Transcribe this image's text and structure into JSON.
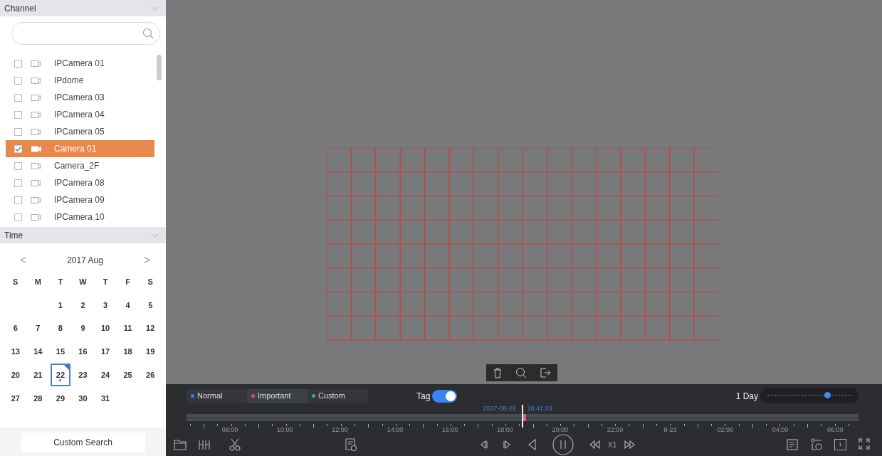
{
  "channel_panel": {
    "title": "Channel",
    "channels": [
      {
        "name": "IPCamera 01",
        "checked": false,
        "selected": false
      },
      {
        "name": "IPdome",
        "checked": false,
        "selected": false
      },
      {
        "name": "IPCamera 03",
        "checked": false,
        "selected": false
      },
      {
        "name": "IPCamera 04",
        "checked": false,
        "selected": false
      },
      {
        "name": "IPCamera 05",
        "checked": false,
        "selected": false
      },
      {
        "name": "Camera 01",
        "checked": true,
        "selected": true
      },
      {
        "name": "Camera_2F",
        "checked": false,
        "selected": false
      },
      {
        "name": "IPCamera 08",
        "checked": false,
        "selected": false
      },
      {
        "name": "IPCamera 09",
        "checked": false,
        "selected": false
      },
      {
        "name": "IPCamera 10",
        "checked": false,
        "selected": false
      }
    ]
  },
  "time_panel": {
    "title": "Time",
    "month": "2017 Aug",
    "prev": "<",
    "next": ">",
    "weekdays": [
      "S",
      "M",
      "T",
      "W",
      "T",
      "F",
      "S"
    ],
    "days": [
      {
        "label": "1",
        "selected": false,
        "has_record": false
      },
      {
        "label": "2",
        "selected": false,
        "has_record": false
      },
      {
        "label": "3",
        "selected": false,
        "has_record": false
      },
      {
        "label": "4",
        "selected": false,
        "has_record": false
      },
      {
        "label": "5",
        "selected": false,
        "has_record": false
      },
      {
        "label": "6",
        "selected": false,
        "has_record": false
      },
      {
        "label": "7",
        "selected": false,
        "has_record": false
      },
      {
        "label": "8",
        "selected": false,
        "has_record": false
      },
      {
        "label": "9",
        "selected": false,
        "has_record": false
      },
      {
        "label": "10",
        "selected": false,
        "has_record": false
      },
      {
        "label": "11",
        "selected": false,
        "has_record": false
      },
      {
        "label": "12",
        "selected": false,
        "has_record": false
      },
      {
        "label": "13",
        "selected": false,
        "has_record": false
      },
      {
        "label": "14",
        "selected": false,
        "has_record": false
      },
      {
        "label": "15",
        "selected": false,
        "has_record": false
      },
      {
        "label": "16",
        "selected": false,
        "has_record": false
      },
      {
        "label": "17",
        "selected": false,
        "has_record": false
      },
      {
        "label": "18",
        "selected": false,
        "has_record": false
      },
      {
        "label": "19",
        "selected": false,
        "has_record": false
      },
      {
        "label": "20",
        "selected": false,
        "has_record": false
      },
      {
        "label": "21",
        "selected": false,
        "has_record": false
      },
      {
        "label": "22",
        "selected": true,
        "has_record": true
      },
      {
        "label": "23",
        "selected": false,
        "has_record": false
      },
      {
        "label": "24",
        "selected": false,
        "has_record": false
      },
      {
        "label": "25",
        "selected": false,
        "has_record": false
      },
      {
        "label": "26",
        "selected": false,
        "has_record": false
      },
      {
        "label": "27",
        "selected": false,
        "has_record": false
      },
      {
        "label": "28",
        "selected": false,
        "has_record": false
      },
      {
        "label": "29",
        "selected": false,
        "has_record": false
      },
      {
        "label": "30",
        "selected": false,
        "has_record": false
      },
      {
        "label": "31",
        "selected": false,
        "has_record": false
      }
    ],
    "custom_search": "Custom Search"
  },
  "legend": [
    {
      "label": "Normal",
      "color": "#3b82f6",
      "selected": false
    },
    {
      "label": "Important",
      "color": "#ef4444",
      "selected": true
    },
    {
      "label": "Custom",
      "color": "#22c55e",
      "selected": false
    }
  ],
  "tag": {
    "label": "Tag",
    "on": true
  },
  "playhead": {
    "date": "2017-08-22",
    "time": "18:41:23",
    "level": 0.5
  },
  "zoom": {
    "label": "1 Day",
    "level": 0.72
  },
  "timeline": {
    "labels": [
      "08:00",
      "10:00",
      "12:00",
      "14:00",
      "16:00",
      "18:00",
      "20:00",
      "22:00",
      "8-23",
      "02:00",
      "04:00",
      "06:00"
    ]
  },
  "speed": "X1",
  "page_indicator": "1"
}
